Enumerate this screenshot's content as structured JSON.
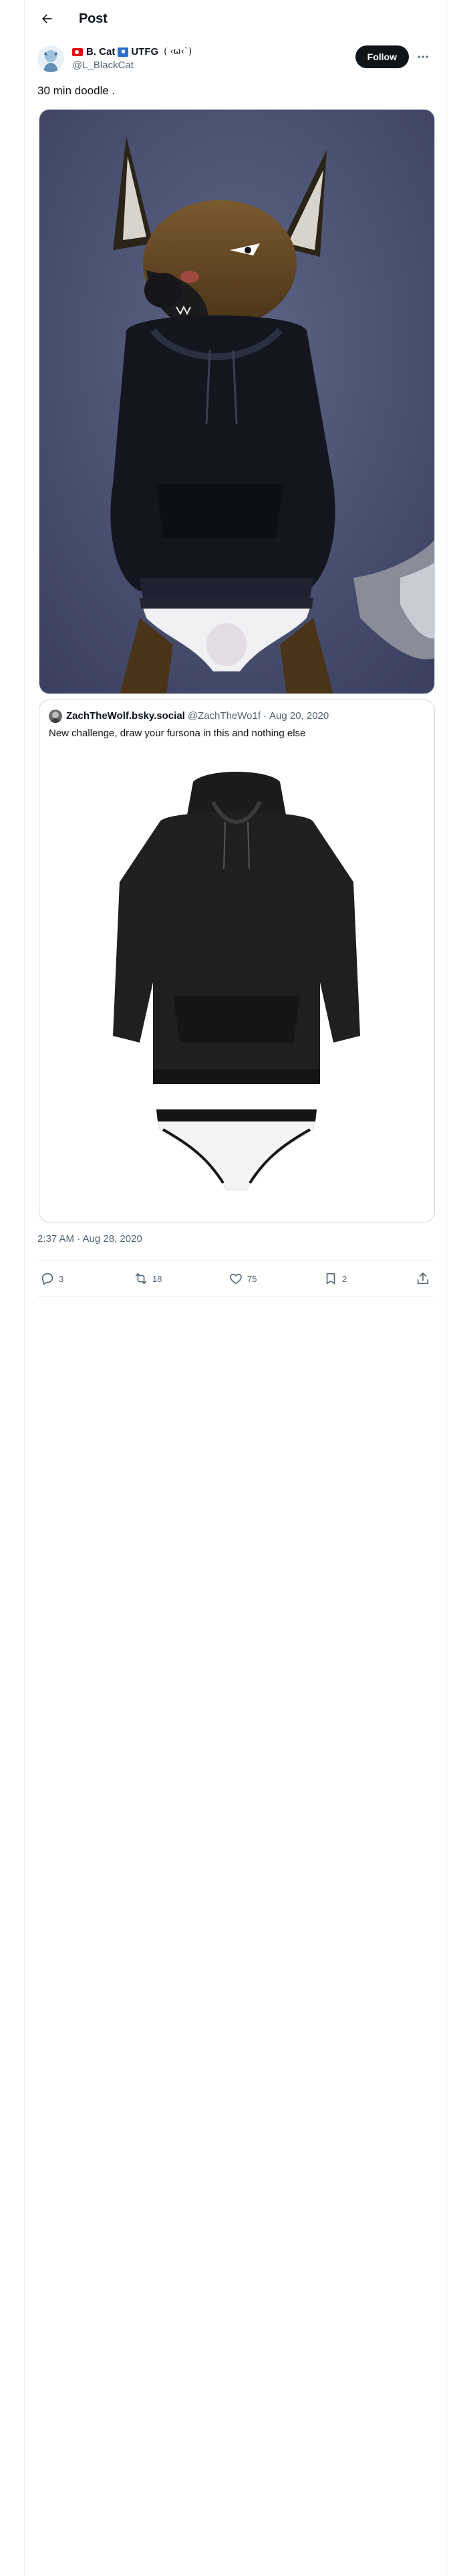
{
  "header": {
    "title": "Post",
    "back_icon": "arrow-left-icon"
  },
  "author": {
    "display_name_part1": "B. Cat",
    "display_name_box": "🇺🇸",
    "display_name_part2": "UTFG",
    "kaomoji": "( ‹ω‹`)",
    "handle": "@L_BlackCat",
    "follow_label": "Follow",
    "more_icon": "more-horizontal-icon"
  },
  "post": {
    "text": "30 min doodle ."
  },
  "quote": {
    "name": "ZachTheWolf.bsky.social",
    "handle": "@ZachTheWo1f",
    "separator": "·",
    "date": "Aug 20, 2020",
    "text": "New challenge, draw your fursona in this and nothing else"
  },
  "meta": {
    "timestamp": "2:37 AM · Aug 28, 2020"
  },
  "actions": {
    "replies": "3",
    "reposts": "18",
    "likes": "75",
    "bookmarks": "2"
  },
  "colors": {
    "text": "#0f1419",
    "secondary": "#536471",
    "border": "#cfd9de",
    "accent": "#1d9bf0"
  }
}
